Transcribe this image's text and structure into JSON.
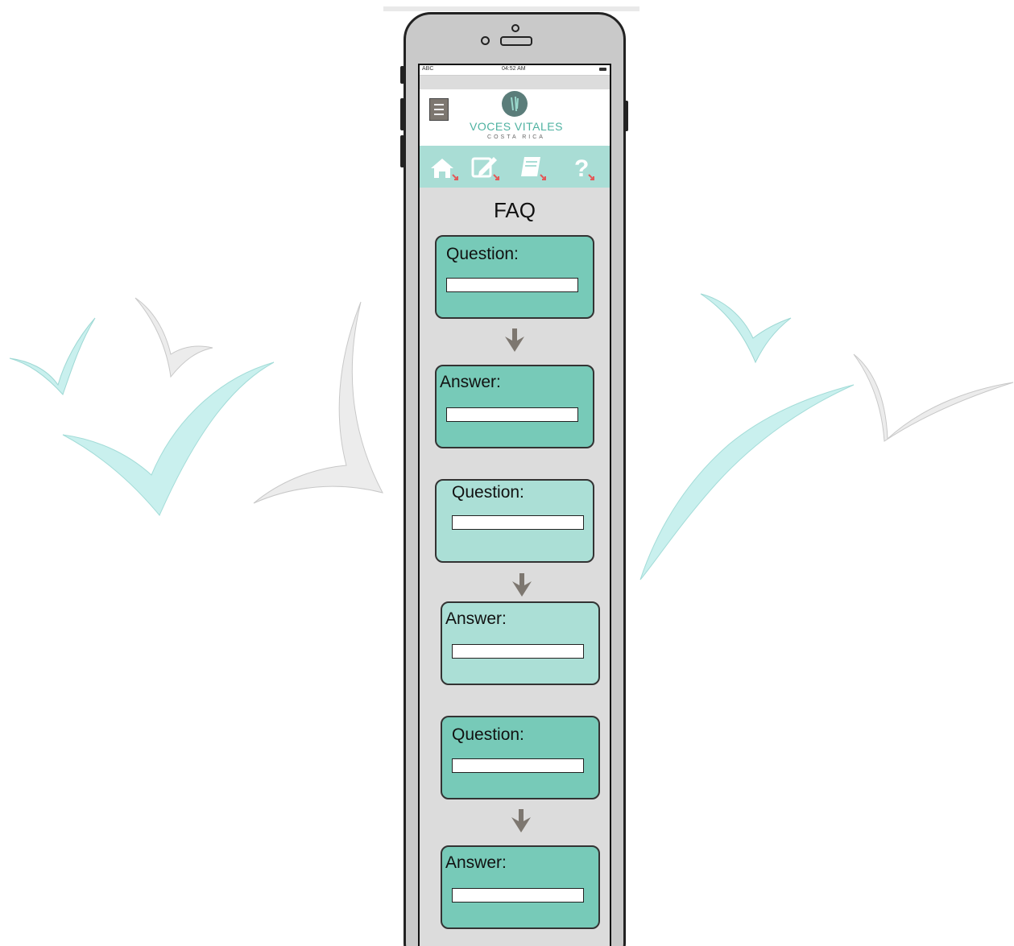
{
  "statusbar": {
    "carrier": "ABC",
    "time": "04:52 AM"
  },
  "logo": {
    "title": "VOCES VITALES",
    "subtitle": "COSTA RICA"
  },
  "nav_icons": [
    "home-icon",
    "edit-icon",
    "book-icon",
    "help-icon"
  ],
  "page": {
    "title": "FAQ"
  },
  "faq_items": [
    {
      "question_label": "Question:",
      "answer_label": "Answer:"
    },
    {
      "question_label": "Question:",
      "answer_label": "Answer:"
    },
    {
      "question_label": "Question:",
      "answer_label": "Answer:"
    }
  ],
  "colors": {
    "teal_dark": "#77cab8",
    "teal_light": "#abdfd6",
    "iconbar": "#a9ddd5",
    "brand_text": "#4eb2a1",
    "screen_bg": "#dcdcdc",
    "arrow_gray": "#7d7770",
    "bird_teal": "#c9f0ee",
    "bird_gray": "#e2e2e2"
  }
}
